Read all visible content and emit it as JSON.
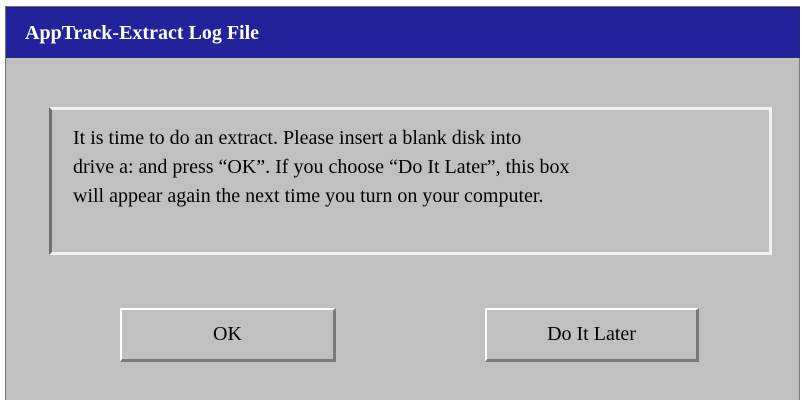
{
  "window": {
    "title": "AppTrack-Extract Log File"
  },
  "message": {
    "lines": [
      "It is time to do an extract.  Please insert a blank disk into",
      "drive a: and press “OK”.  If you choose “Do It Later”, this box",
      "will appear again the next time you turn on your computer."
    ]
  },
  "buttons": {
    "ok_label": "OK",
    "later_label": "Do It Later"
  },
  "colors": {
    "titlebar": "#22229a",
    "title_text": "#ffffff",
    "dialog_face": "#c0c0c0"
  }
}
